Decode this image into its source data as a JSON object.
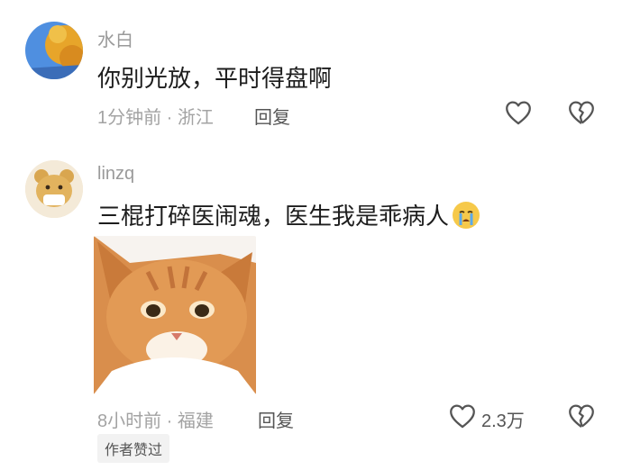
{
  "comments": [
    {
      "username": "水白",
      "text": "你别光放，平时得盘啊",
      "meta": "1分钟前 · 浙江",
      "reply_label": "回复",
      "like_count": ""
    },
    {
      "username": "linzq",
      "text": "三棍打碎医闹魂，医生我是乖病人",
      "emoji": "crying-face",
      "meta": "8小时前 · 福建",
      "reply_label": "回复",
      "like_count": "2.3万",
      "badge": "作者赞过"
    }
  ],
  "icons": {
    "like": "heart-outline-icon",
    "dislike": "broken-heart-icon"
  },
  "colors": {
    "meta_gray": "#a3a3a3",
    "text_dark": "#1d1d1d",
    "emoji_yellow": "#f6c94a"
  }
}
